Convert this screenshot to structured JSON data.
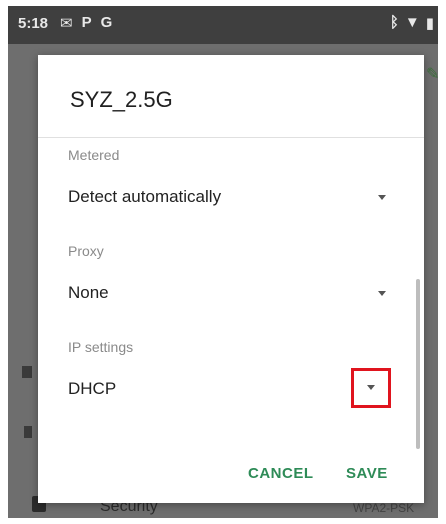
{
  "status_bar": {
    "time": "5:18",
    "notification_icons": [
      "mail-icon",
      "p-icon",
      "g-icon"
    ],
    "system_icons": [
      "bluetooth-icon",
      "wifi-icon",
      "battery-icon"
    ]
  },
  "background": {
    "security_label": "Security",
    "security_value": "WPA2-PSK"
  },
  "dialog": {
    "title": "SYZ_2.5G",
    "metered": {
      "label": "Metered",
      "value": "Detect automatically"
    },
    "proxy": {
      "label": "Proxy",
      "value": "None"
    },
    "ip_settings": {
      "label": "IP settings",
      "value": "DHCP"
    },
    "cancel_label": "CANCEL",
    "save_label": "SAVE"
  },
  "colors": {
    "accent": "#2e8b57",
    "highlight_box": "#e0141e",
    "status_bar": "#3f3f3f"
  }
}
